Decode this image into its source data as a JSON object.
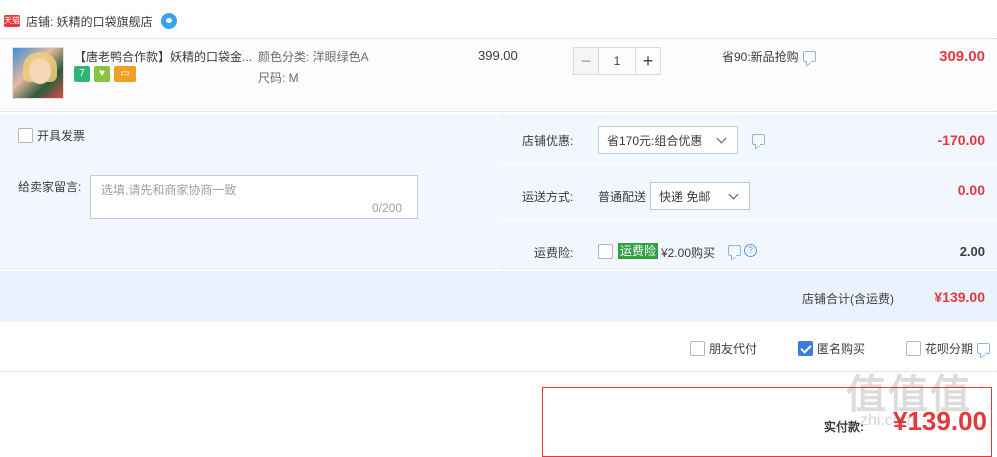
{
  "store": {
    "badge": "天猫",
    "name": "店铺: 妖精的口袋旗舰店"
  },
  "item": {
    "title": "【唐老鸭合作款】妖精的口袋金...",
    "color_label": "颜色分类: 洋眼绿色A",
    "size_label": "尺码: M",
    "unit_price": "399.00",
    "quantity": "1",
    "minus": "−",
    "plus": "+",
    "promo": "省90:新品抢购",
    "total": "309.00",
    "badge_icons": [
      "7-day-return-icon",
      "guarantee-icon",
      "card-icon"
    ]
  },
  "invoice": {
    "label": "开具发票"
  },
  "message": {
    "label": "给卖家留言:",
    "placeholder": "选填,请先和商家协商一致",
    "count": "0/200"
  },
  "shop_discount": {
    "label": "店铺优惠:",
    "selected": "省170元:组合优惠",
    "amount": "-170.00"
  },
  "shipping": {
    "label": "运送方式:",
    "mode": "普通配送",
    "selected": "快递 免邮",
    "amount": "0.00"
  },
  "insurance": {
    "label": "运费险:",
    "tag": "运费险",
    "price": "¥2.00购买",
    "amount": "2.00"
  },
  "summary": {
    "label": "店铺合计(含运费)",
    "amount": "¥139.00"
  },
  "pay_options": {
    "friend": "朋友代付",
    "anonymous": "匿名购买",
    "huabei": "花呗分期"
  },
  "payment": {
    "label": "实付款:",
    "amount": "¥139.00"
  },
  "watermark": {
    "main": "值值值",
    "sub": "zhi.com"
  },
  "colors": {
    "accent": "#e4393c",
    "blue_bg": "#f2f7ff",
    "link": "#3a7be0"
  }
}
